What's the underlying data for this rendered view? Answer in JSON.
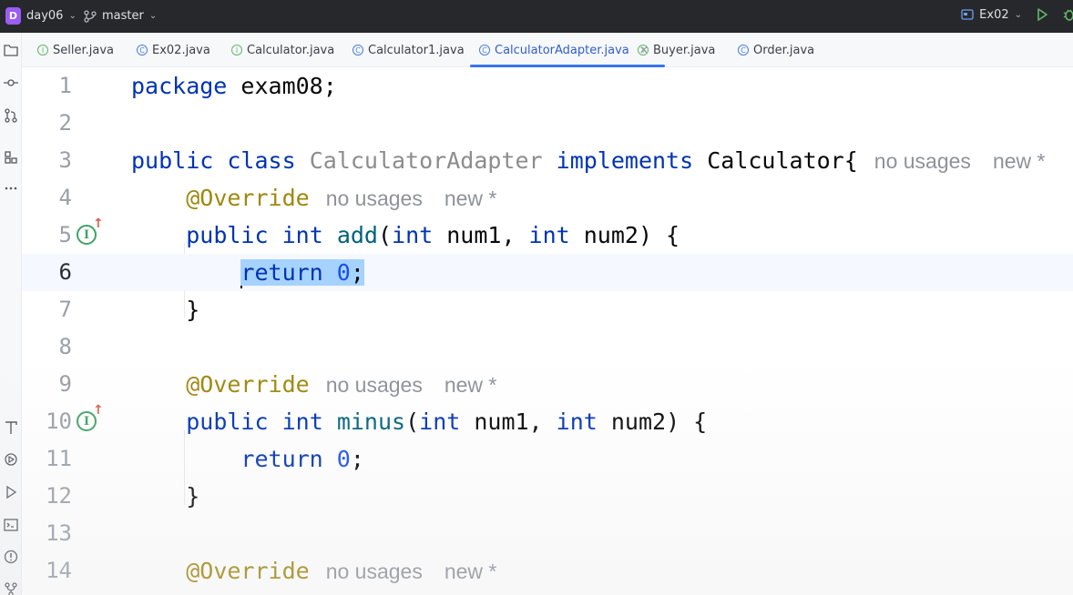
{
  "titlebar": {
    "project_badge": "D",
    "project_name": "day06",
    "branch": "master",
    "run_config": "Ex02"
  },
  "tabs": [
    {
      "label": "Seller.java",
      "icon": "interface-icon"
    },
    {
      "label": "Ex02.java",
      "icon": "class-run-icon"
    },
    {
      "label": "Calculator.java",
      "icon": "interface-icon"
    },
    {
      "label": "Calculator1.java",
      "icon": "class-icon"
    },
    {
      "label": "CalculatorAdapter.java",
      "icon": "class-icon",
      "active": true
    },
    {
      "label": "Buyer.java",
      "icon": "interface-icon"
    },
    {
      "label": "Order.java",
      "icon": "class-icon"
    }
  ],
  "editor": {
    "lines": [
      "1",
      "2",
      "3",
      "4",
      "5",
      "6",
      "7",
      "8",
      "9",
      "10",
      "11",
      "12",
      "13",
      "14"
    ],
    "code": {
      "l1_kw": "package",
      "l1_rest": " exam08;",
      "l3_kw1": "public",
      "l3_kw2": "class",
      "l3_name": "CalculatorAdapter",
      "l3_kw3": "implements",
      "l3_iface": "Calculator{",
      "l4_ann": "@Override",
      "l5_kw1": "public",
      "l5_kw2": "int",
      "l5_fn": "add",
      "l5_p1": "(",
      "l5_kw3": "int",
      "l5_p2": " num1, ",
      "l5_kw4": "int",
      "l5_p3": " num2) {",
      "l6_kw": "return",
      "l6_num": "0",
      "l6_end": ";",
      "l7": "}",
      "l9_ann": "@Override",
      "l10_kw1": "public",
      "l10_kw2": "int",
      "l10_fn": "minus",
      "l10_p1": "(",
      "l10_kw3": "int",
      "l10_p2": " num1, ",
      "l10_kw4": "int",
      "l10_p3": " num2) {",
      "l11_kw": "return",
      "l11_num": "0",
      "l11_end": ";",
      "l12": "}",
      "l14_ann": "@Override"
    },
    "hints": {
      "usages": "no usages",
      "new": "new *"
    }
  },
  "colors": {
    "keyword": "#0033b3",
    "annotation": "#9e880d",
    "number": "#1750eb",
    "function": "#00627a",
    "selection": "#a6d2ff",
    "active_tab_underline": "#3574f0"
  }
}
